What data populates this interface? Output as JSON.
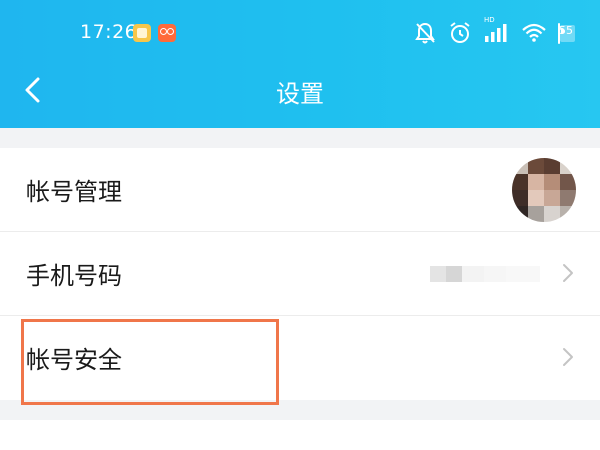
{
  "status_bar": {
    "time": "17:26",
    "network_label": "HD",
    "battery_level": "55",
    "battery_fraction": 0.55,
    "icons": [
      "notes-app-icon",
      "kuaishou-app-icon",
      "bell-muted-icon",
      "alarm-icon",
      "signal-icon",
      "wifi-icon",
      "battery-icon"
    ]
  },
  "nav": {
    "title": "设置",
    "back_icon": "chevron-left-icon"
  },
  "settings": {
    "items": [
      {
        "label": "帐号管理",
        "trailing": "avatar"
      },
      {
        "label": "手机号码",
        "trailing": "chevron-right-icon"
      },
      {
        "label": "帐号安全",
        "trailing": "chevron-right-icon"
      }
    ]
  },
  "annotation": {
    "highlighted_item": "帐号安全",
    "color": "#f0764a"
  },
  "colors": {
    "header": "#1fb6ef",
    "background": "#f2f3f5",
    "row_background": "#ffffff",
    "text": "#1a1a1a"
  }
}
